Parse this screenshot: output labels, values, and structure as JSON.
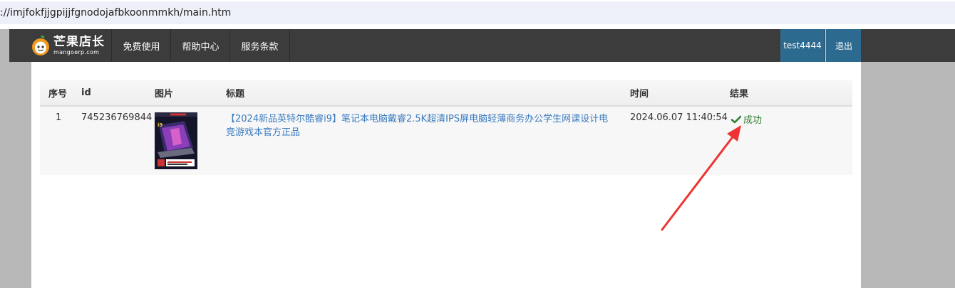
{
  "browser": {
    "url": "://imjfokfjjgpijjfgnodojafbkoonmmkh/main.htm"
  },
  "nav": {
    "brand_title": "芒果店长",
    "brand_sub": "mangoerp.com",
    "items": [
      "免费使用",
      "帮助中心",
      "服务条款"
    ],
    "user": "test4444",
    "logout": "退出"
  },
  "table": {
    "headers": {
      "index": "序号",
      "id": "id",
      "image": "图片",
      "title": "标题",
      "time": "时间",
      "result": "结果"
    },
    "rows": [
      {
        "index": "1",
        "id": "745236769844",
        "title": "【2024新品英特尔酷睿i9】笔记本电脑戴睿2.5K超清IPS屏电脑轻薄商务办公学生网课设计电竞游戏本官方正品",
        "time": "2024.06.07 11:40:54",
        "result": "成功",
        "result_icon": "check-icon"
      }
    ]
  },
  "colors": {
    "nav_bg": "#3c3c3c",
    "user_bg": "#2d6a8f",
    "link": "#3a7bbf",
    "success": "#2f7d32",
    "annotation_arrow": "#ee3333"
  }
}
